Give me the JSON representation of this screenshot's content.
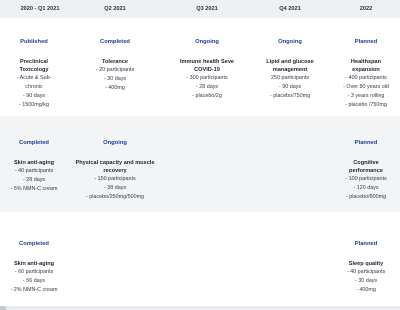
{
  "header": {
    "columns": [
      "2020 - Q1 2021",
      "Q2 2021",
      "Q3 2021",
      "Q4 2021",
      "2022"
    ]
  },
  "rows": [
    {
      "cells": [
        {
          "status": "Published",
          "title": "Preclinical\nToxicology",
          "details": [
            "- Acute & Sub-",
            "chronic",
            "- 90 days",
            "- 1500mg/kg"
          ]
        },
        {
          "status": "Completed",
          "title": "Tolerance",
          "details": [
            "- 20 participants",
            "- 30 days",
            "- 400mg"
          ]
        },
        {
          "status": "Ongoing",
          "title": "Immune health Seve\nCOVID-19",
          "details": [
            "- 300 participants",
            "- 28 days",
            "- placebo/2g"
          ]
        },
        {
          "status": "Ongoing",
          "title": "Lipid and glucose\nmanagement",
          "details": [
            "250 participants",
            "- 90 days",
            "- placebo/750mg"
          ]
        },
        {
          "status": "Planned",
          "title": "Healthspan\nexpansion",
          "details": [
            "- 400 participants",
            "- Over 80 years old",
            "- 3 years rolling",
            "- placebo /750mg"
          ]
        }
      ]
    },
    {
      "cells": [
        {
          "status": "Completed",
          "title": "Skin anti-aging",
          "details": [
            "- 40 participants",
            "- 28 days",
            "- 5% NMN-C cream"
          ]
        },
        {
          "status": "Ongoing",
          "title": "Physical capacity and muscle\nrecovery",
          "details": [
            "- 150 participants",
            "- 38 days",
            "- placebo/250mg/500mg"
          ]
        },
        {
          "status": "",
          "title": "",
          "details": []
        },
        {
          "status": "",
          "title": "",
          "details": []
        },
        {
          "status": "Planned",
          "title": "Cognitive\nperformance",
          "details": [
            "- 100 participants",
            "- 120 days",
            "- placebo/600mg"
          ]
        }
      ]
    },
    {
      "cells": [
        {
          "status": "Completed",
          "title": "Skin anti-aging",
          "details": [
            "- 60 participants",
            "- 56 days",
            "- 2% NMN-C cream"
          ]
        },
        {
          "status": "",
          "title": "",
          "details": []
        },
        {
          "status": "",
          "title": "",
          "details": []
        },
        {
          "status": "",
          "title": "",
          "details": []
        },
        {
          "status": "Planned",
          "title": "Sleep quality",
          "details": [
            "- 40 participants",
            "- 30 days",
            "- 400mg"
          ]
        }
      ]
    }
  ],
  "colors": {
    "status": "#1e3f8f",
    "header_bg": "#eef0f4",
    "alt_row_bg": "#f2f4f6"
  }
}
